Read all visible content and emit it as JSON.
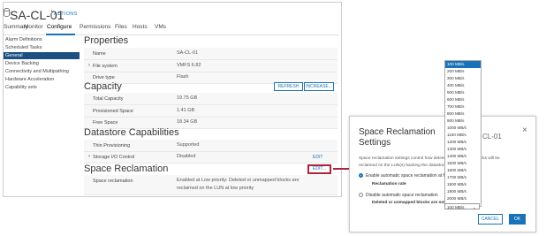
{
  "header": {
    "title": "SA-CL-01",
    "actions": "ACTIONS"
  },
  "tabs": [
    "Summary",
    "Monitor",
    "Configure",
    "Permissions",
    "Files",
    "Hosts",
    "VMs"
  ],
  "sidebar": [
    "Alarm Definitions",
    "Scheduled Tasks",
    "General",
    "Device Backing",
    "Connectivity and Multipathing",
    "Hardware Acceleration",
    "Capability sets"
  ],
  "properties": {
    "title": "Properties",
    "rows": [
      {
        "label": "Name",
        "value": "SA-CL-01"
      },
      {
        "label": "File system",
        "value": "VMFS 6.82"
      },
      {
        "label": "Drive type",
        "value": "Flash"
      }
    ]
  },
  "capacity": {
    "title": "Capacity",
    "refresh": "REFRESH",
    "increase": "INCREASE...",
    "rows": [
      {
        "label": "Total Capacity",
        "value": "19.75 GB"
      },
      {
        "label": "Provisioned Space",
        "value": "1.41 GB"
      },
      {
        "label": "Free Space",
        "value": "18.34 GB"
      }
    ]
  },
  "datastore": {
    "title": "Datastore Capabilities",
    "rows": [
      {
        "label": "Thin Provisioning",
        "value": "Supported"
      },
      {
        "label": "Storage I/O Control",
        "value": "Disabled",
        "action": "EDIT"
      }
    ]
  },
  "space_reclamation": {
    "title": "Space Reclamation",
    "edit": "EDIT...",
    "label": "Space reclamation",
    "value_line1": "Enabled at Low priority: Deleted or unmapped blocks are",
    "value_line2": "reclaimed on the LUN at low priority"
  },
  "dialog": {
    "title_line1": "Space Reclamation",
    "title_line2": "Settings",
    "hidden_title": "CL-01",
    "close": "×",
    "text_line1": "Space reclamation settings control how deleted or unmapped blocks will be",
    "text_line2": "reclaimed on the LUN(s) backing the datastore.",
    "enable_label": "Enable automatic space reclamation at fixed rate",
    "rate_label": "Reclamation rate",
    "disable_label": "Disable automatic space reclamation",
    "disable_note": "Deleted or unmapped blocks are not reclaimed",
    "cancel": "CANCEL",
    "ok": "OK"
  },
  "rate_options": [
    "100 MB/s",
    "200 MB/s",
    "300 MB/s",
    "400 MB/s",
    "500 MB/s",
    "600 MB/s",
    "700 MB/s",
    "800 MB/s",
    "900 MB/s",
    "1000 MB/s",
    "1100 MB/s",
    "1200 MB/s",
    "1300 MB/s",
    "1400 MB/s",
    "1500 MB/s",
    "1600 MB/s",
    "1700 MB/s",
    "1800 MB/s",
    "1900 MB/s",
    "2000 MB/s"
  ],
  "rate_selected": "100 MB/s",
  "colors": {
    "accent": "#1a73b8",
    "sidebar_selected": "#1c4f82",
    "highlight": "#b0243b"
  }
}
